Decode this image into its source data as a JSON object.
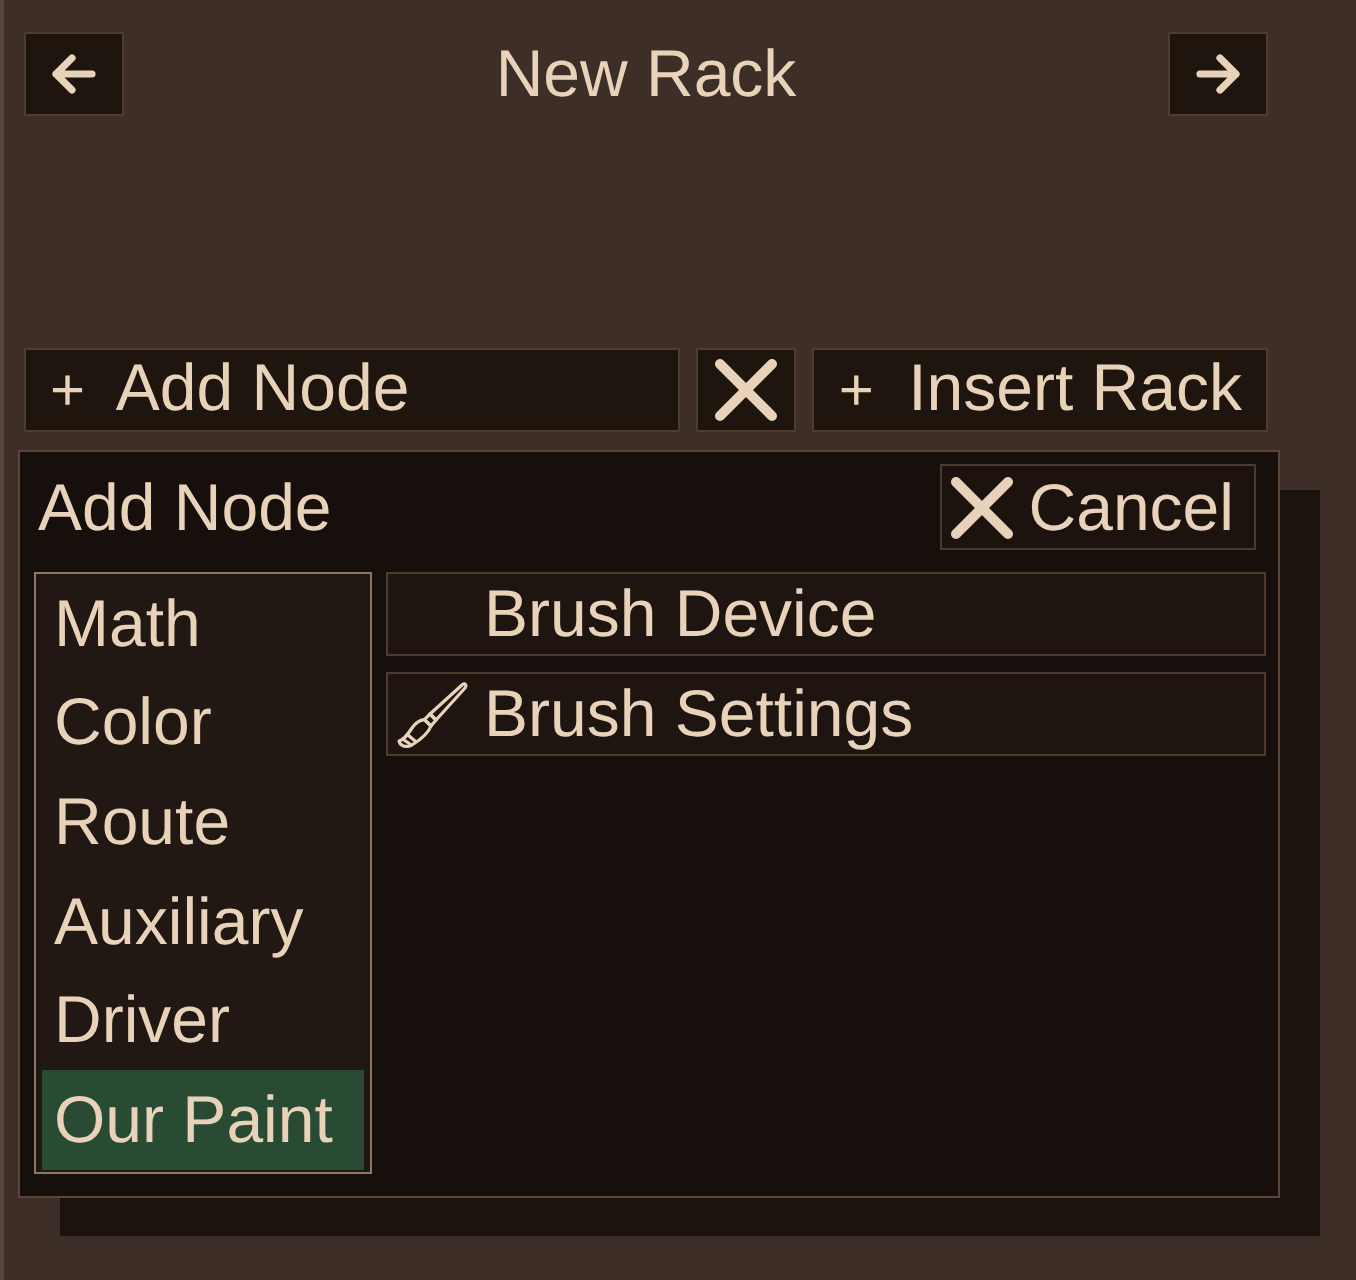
{
  "header": {
    "title": "New Rack"
  },
  "toolbar": [
    {
      "kind": "add",
      "prefix": "+",
      "label": "Add Node"
    },
    {
      "kind": "clear"
    },
    {
      "kind": "add",
      "prefix": "+",
      "label": "Insert Rack"
    }
  ],
  "dialog": {
    "title": "Add Node",
    "cancel": {
      "label": "Cancel"
    },
    "categories": [
      {
        "label": "Math",
        "selected": false
      },
      {
        "label": "Color",
        "selected": false
      },
      {
        "label": "Route",
        "selected": false
      },
      {
        "label": "Auxiliary",
        "selected": false
      },
      {
        "label": "Driver",
        "selected": false
      },
      {
        "label": "Our Paint",
        "selected": true
      }
    ],
    "nodes": [
      {
        "kind": "plain",
        "label": "Brush Device"
      },
      {
        "kind": "brush",
        "label": "Brush Settings"
      }
    ]
  }
}
